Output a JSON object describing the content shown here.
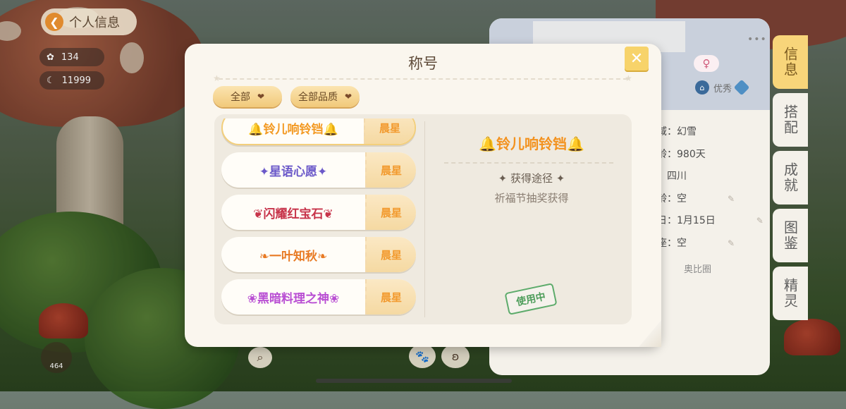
{
  "header": {
    "back_label": "个人信息"
  },
  "stats": [
    {
      "icon": "flower-icon",
      "value": "134"
    },
    {
      "icon": "moon-coin-icon",
      "value": "11999"
    }
  ],
  "bottom": {
    "badge_value": "464"
  },
  "modal": {
    "title": "称号",
    "close_icon": "close-icon",
    "filters": [
      {
        "label": "全部"
      },
      {
        "label": "全部品质"
      }
    ],
    "titles": [
      {
        "name": "铃儿响铃铛",
        "rank": "晨星",
        "color": "#f39a24"
      },
      {
        "name": "星语心愿",
        "rank": "晨星",
        "color": "#6b59c9"
      },
      {
        "name": "闪耀红宝石",
        "rank": "晨星",
        "color": "#c7334a"
      },
      {
        "name": "一叶知秋",
        "rank": "晨星",
        "color": "#e87a24"
      },
      {
        "name": "黑暗料理之神",
        "rank": "晨星",
        "color": "#b94fd3"
      }
    ],
    "detail": {
      "title": "铃儿响铃铛",
      "source_label": "获得途径",
      "source_value": "祈福节抽奖获得",
      "status": "使用中"
    }
  },
  "profile": {
    "quality": "优秀",
    "rows": [
      "域：幻雪",
      "龄：980天",
      "：四川",
      "龄：空",
      "日：1月15日",
      "座：空"
    ],
    "circle_label": "奥比圈"
  },
  "side_tabs": [
    {
      "label": "信息",
      "active": true
    },
    {
      "label": "搭配",
      "active": false
    },
    {
      "label": "成就",
      "active": false
    },
    {
      "label": "图鉴",
      "active": false
    },
    {
      "label": "精灵",
      "active": false
    }
  ]
}
